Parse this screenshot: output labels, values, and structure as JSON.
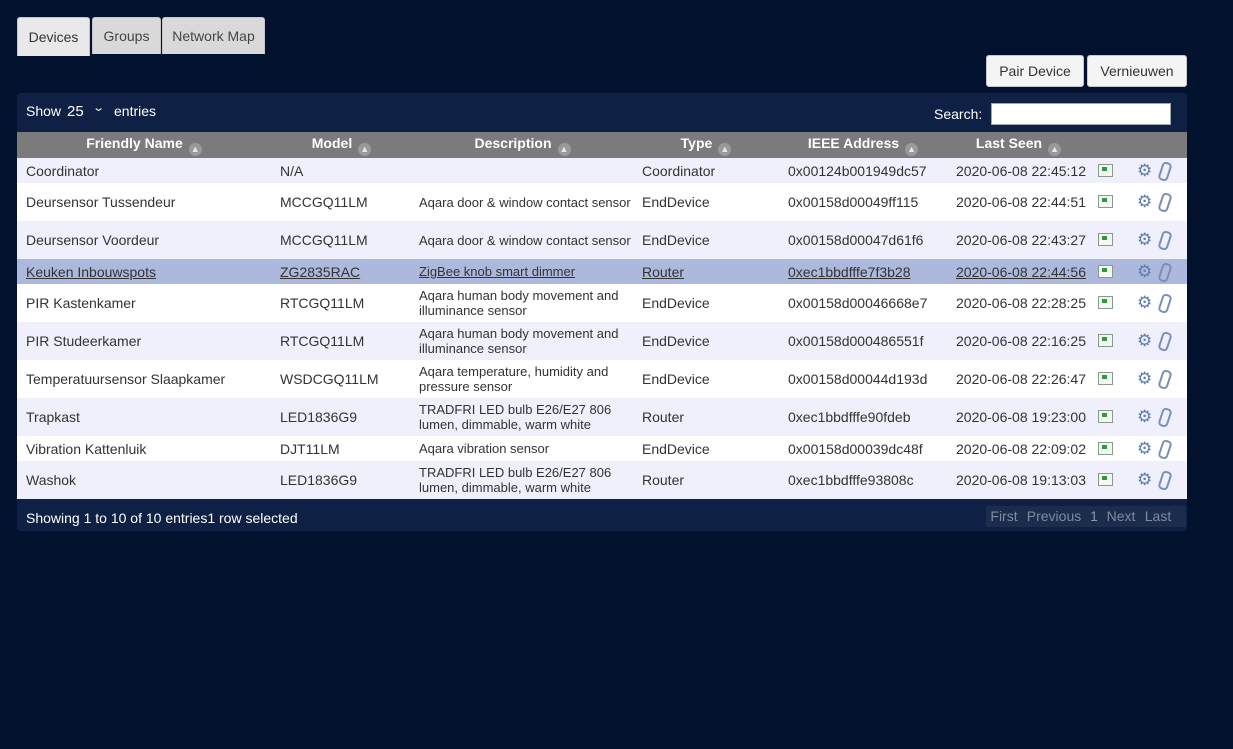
{
  "tabs": [
    "Devices",
    "Groups",
    "Network Map"
  ],
  "buttons": {
    "pair": "Pair Device",
    "refresh": "Vernieuwen"
  },
  "toolbar": {
    "show": "Show",
    "page_size": "25",
    "entries": "entries",
    "search": "Search:",
    "search_value": ""
  },
  "columns": [
    "Friendly Name",
    "Model",
    "Description",
    "Type",
    "IEEE Address",
    "Last Seen"
  ],
  "rows": [
    {
      "name": "Coordinator",
      "model": "N/A",
      "description": "",
      "type": "Coordinator",
      "ieee": "0x00124b001949dc57",
      "last_seen": "2020-06-08 22:45:12"
    },
    {
      "name": "Deursensor Tussendeur",
      "model": "MCCGQ11LM",
      "description": "Aqara door & window contact sensor",
      "type": "EndDevice",
      "ieee": "0x00158d00049ff115",
      "last_seen": "2020-06-08 22:44:51"
    },
    {
      "name": "Deursensor Voordeur",
      "model": "MCCGQ11LM",
      "description": "Aqara door & window contact sensor",
      "type": "EndDevice",
      "ieee": "0x00158d00047d61f6",
      "last_seen": "2020-06-08 22:43:27"
    },
    {
      "name": "Keuken Inbouwspots",
      "model": "ZG2835RAC",
      "description": "ZigBee knob smart dimmer",
      "type": "Router",
      "ieee": "0xec1bbdfffe7f3b28",
      "last_seen": "2020-06-08 22:44:56"
    },
    {
      "name": "PIR Kastenkamer",
      "model": "RTCGQ11LM",
      "description": "Aqara human body movement and illuminance sensor",
      "type": "EndDevice",
      "ieee": "0x00158d00046668e7",
      "last_seen": "2020-06-08 22:28:25"
    },
    {
      "name": "PIR Studeerkamer",
      "model": "RTCGQ11LM",
      "description": "Aqara human body movement and illuminance sensor",
      "type": "EndDevice",
      "ieee": "0x00158d000486551f",
      "last_seen": "2020-06-08 22:16:25"
    },
    {
      "name": "Temperatuursensor Slaapkamer",
      "model": "WSDCGQ11LM",
      "description": "Aqara temperature, humidity and pressure sensor",
      "type": "EndDevice",
      "ieee": "0x00158d00044d193d",
      "last_seen": "2020-06-08 22:26:47"
    },
    {
      "name": "Trapkast",
      "model": "LED1836G9",
      "description": "TRADFRI LED bulb E26/E27 806 lumen, dimmable, warm white",
      "type": "Router",
      "ieee": "0xec1bbdfffe90fdeb",
      "last_seen": "2020-06-08 19:23:00"
    },
    {
      "name": "Vibration Kattenluik",
      "model": "DJT11LM",
      "description": "Aqara vibration sensor",
      "type": "EndDevice",
      "ieee": "0x00158d00039dc48f",
      "last_seen": "2020-06-08 22:09:02"
    },
    {
      "name": "Washok",
      "model": "LED1836G9",
      "description": "TRADFRI LED bulb E26/E27 806 lumen, dimmable, warm white",
      "type": "Router",
      "ieee": "0xec1bbdfffe93808c",
      "last_seen": "2020-06-08 19:13:03"
    }
  ],
  "footer": {
    "info": "Showing 1 to 10 of 10 entries1 row selected"
  },
  "pager": {
    "first": "First",
    "previous": "Previous",
    "page": "1",
    "next": "Next",
    "last": "Last"
  },
  "icons": {
    "sort": "sort-arrow-icon",
    "status": "status-chart-icon",
    "settings": "gear-icon",
    "bind": "paperclip-icon"
  },
  "colors": {
    "background": "#02112e",
    "panel": "#0e2144",
    "header": "#7b7b7b",
    "row_alt": "#eff0fb",
    "row_selected": "#acb9dd"
  }
}
